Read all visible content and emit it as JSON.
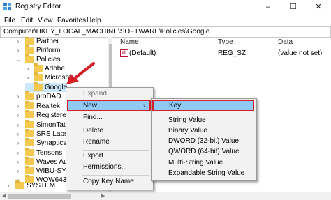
{
  "window": {
    "title": "Registry Editor",
    "minimize": "–",
    "maximize": "☐",
    "close": "✕"
  },
  "menu": {
    "items": [
      "File",
      "Edit",
      "View",
      "Favorites",
      "Help"
    ]
  },
  "address": {
    "path": "Computer\\HKEY_LOCAL_MACHINE\\SOFTWARE\\Policies\\Google"
  },
  "tree": {
    "items": [
      {
        "label": "Partner",
        "expand": "›"
      },
      {
        "label": "Piriform",
        "expand": "›"
      },
      {
        "label": "Policies",
        "expand": "⌄"
      },
      {
        "label": "Adobe",
        "expand": "›"
      },
      {
        "label": "Microsoft",
        "expand": "›"
      },
      {
        "label": "Google",
        "expand": ""
      },
      {
        "label": "proDAD",
        "expand": "›"
      },
      {
        "label": "Realtek",
        "expand": "›"
      },
      {
        "label": "RegisteredA",
        "expand": "›"
      },
      {
        "label": "SimonTath",
        "expand": "›"
      },
      {
        "label": "SRS Labs",
        "expand": "›"
      },
      {
        "label": "Synaptics",
        "expand": "›"
      },
      {
        "label": "Tensons",
        "expand": "›"
      },
      {
        "label": "Waves Aud",
        "expand": "›"
      },
      {
        "label": "WIBU-SYST",
        "expand": "›"
      },
      {
        "label": "WOW6432N",
        "expand": "›"
      },
      {
        "label": "SYSTEM",
        "expand": "›"
      }
    ]
  },
  "values_pane": {
    "headers": {
      "name": "Name",
      "type": "Type",
      "data": "Data"
    },
    "rows": [
      {
        "icon": "ab",
        "name": "(Default)",
        "type": "REG_SZ",
        "data": "(value not set)"
      }
    ]
  },
  "context_menu": {
    "items": [
      "Expand",
      "New",
      "Find...",
      "Delete",
      "Rename",
      "Export",
      "Permissions...",
      "Copy Key Name"
    ],
    "submenu_indicator": "›"
  },
  "submenu": {
    "items": [
      "Key",
      "String Value",
      "Binary Value",
      "DWORD (32-bit) Value",
      "QWORD (64-bit) Value",
      "Multi-String Value",
      "Expandable String Value"
    ]
  },
  "colors": {
    "highlight_border": "#d61f26",
    "highlight_fill": "#91c9f7",
    "folder": "#f3c94f"
  }
}
